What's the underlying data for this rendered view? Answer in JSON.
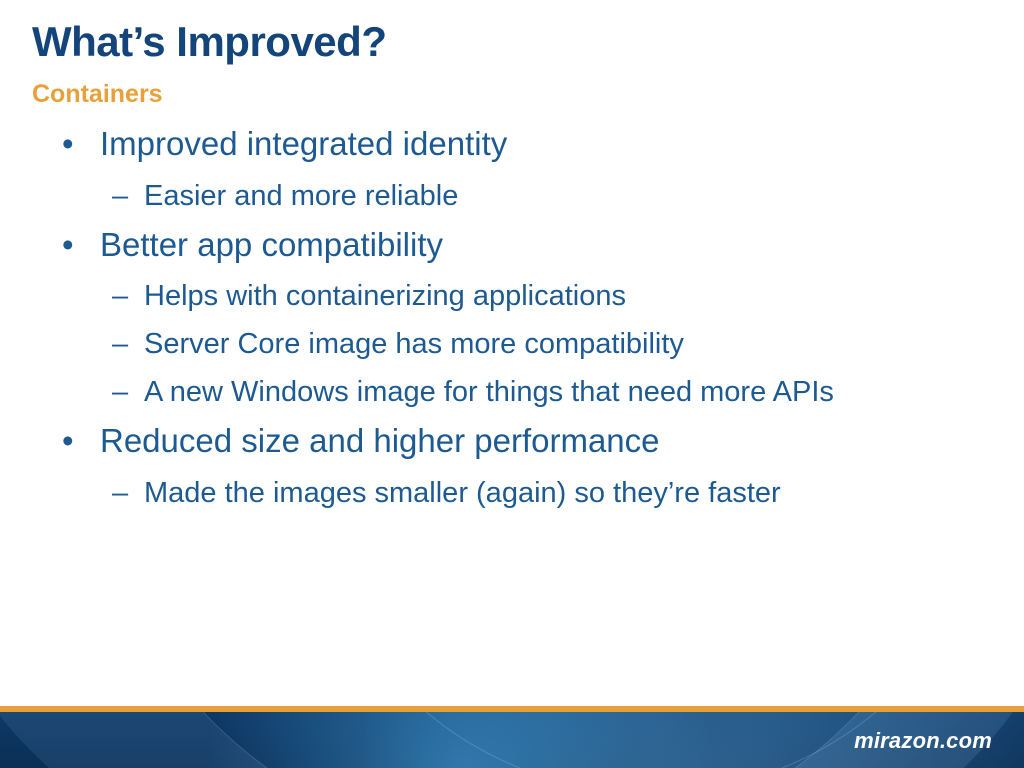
{
  "title": "What’s Improved?",
  "subtitle": "Containers",
  "bullets": [
    {
      "text": "Improved integrated identity",
      "sub": [
        "Easier and more reliable"
      ]
    },
    {
      "text": "Better app compatibility",
      "sub": [
        "Helps with containerizing applications",
        "Server Core image has more compatibility",
        "A new Windows image for things that need more APIs"
      ]
    },
    {
      "text": "Reduced size and higher performance",
      "sub": [
        "Made the images smaller (again) so they’re faster"
      ]
    }
  ],
  "footer": "mirazon.com"
}
